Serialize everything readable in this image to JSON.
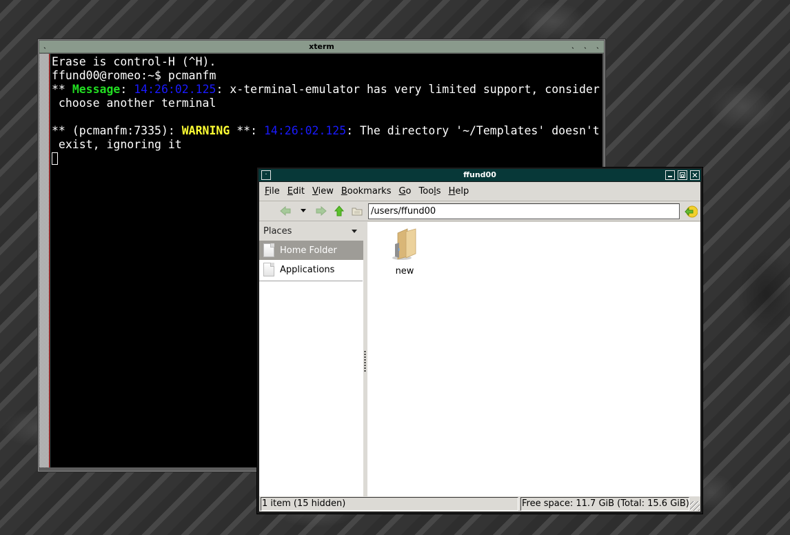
{
  "xterm": {
    "title": "xterm",
    "lines": [
      [
        {
          "t": "Erase is control-H (^H).",
          "c": ""
        }
      ],
      [
        {
          "t": "ffund00@romeo:~$ pcmanfm",
          "c": ""
        }
      ],
      [
        {
          "t": "** ",
          "c": ""
        },
        {
          "t": "Message",
          "c": "c-green"
        },
        {
          "t": ": ",
          "c": ""
        },
        {
          "t": "14:26:02.125",
          "c": "c-blue"
        },
        {
          "t": ": x-terminal-emulator has very limited support, consider",
          "c": ""
        }
      ],
      [
        {
          "t": " choose another terminal",
          "c": ""
        }
      ],
      [
        {
          "t": "",
          "c": ""
        }
      ],
      [
        {
          "t": "** (pcmanfm:7335): ",
          "c": ""
        },
        {
          "t": "WARNING",
          "c": "c-yellow"
        },
        {
          "t": " **: ",
          "c": ""
        },
        {
          "t": "14:26:02.125",
          "c": "c-blue"
        },
        {
          "t": ": The directory '~/Templates' doesn't",
          "c": ""
        }
      ],
      [
        {
          "t": " exist, ignoring it",
          "c": ""
        }
      ]
    ]
  },
  "filemanager": {
    "title": "ffund00",
    "window_buttons": {
      "minimize": "▬",
      "maximize": "◰",
      "close": "✕"
    },
    "menu": [
      {
        "label": "File",
        "accel": "F",
        "rest": "ile"
      },
      {
        "label": "Edit",
        "accel": "E",
        "rest": "dit"
      },
      {
        "label": "View",
        "accel": "V",
        "rest": "iew"
      },
      {
        "label": "Bookmarks",
        "accel": "B",
        "rest": "ookmarks"
      },
      {
        "label": "Go",
        "accel": "G",
        "rest": "o"
      },
      {
        "label": "Tools",
        "pre": "Too",
        "accel": "l",
        "rest": "s"
      },
      {
        "label": "Help",
        "accel": "H",
        "rest": "elp"
      }
    ],
    "address": "/users/ffund00",
    "sidebar": {
      "header": "Places",
      "items": [
        {
          "label": "Home Folder",
          "active": true
        },
        {
          "label": "Applications",
          "active": false
        }
      ]
    },
    "files": [
      {
        "name": "new",
        "type": "folder"
      }
    ],
    "status": {
      "left": "1 item (15 hidden)",
      "right": "Free space: 11.7 GiB (Total: 15.6 GiB)"
    }
  }
}
